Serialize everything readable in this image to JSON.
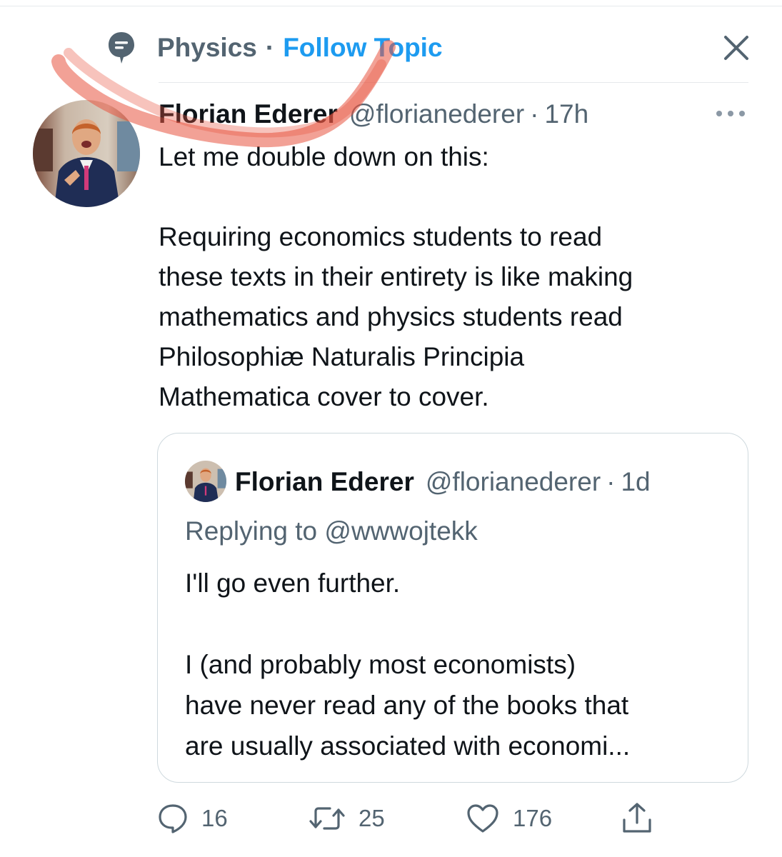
{
  "topic": {
    "name": "Physics",
    "separator": "·",
    "follow_label": "Follow Topic"
  },
  "tweet": {
    "author_name": "Florian Ederer",
    "author_handle": "@florianederer",
    "separator": "·",
    "time": "17h",
    "body_lines": [
      "Let me double down on this:",
      "",
      "Requiring economics students to read",
      "these texts in their entirety is like making",
      "mathematics and physics students read",
      "Philosophiæ Naturalis Principia",
      "Mathematica cover to cover."
    ]
  },
  "quote": {
    "author_name": "Florian Ederer",
    "author_handle": "@florianederer",
    "separator": "·",
    "time": "1d",
    "replying_prefix": "Replying to",
    "replying_handle": "@wwwojtekk",
    "body_lines": [
      "I'll go even further.",
      "",
      "I (and probably most economists)",
      "have never read any of the books that",
      "are usually associated with economi..."
    ]
  },
  "actions": {
    "reply_count": "16",
    "retweet_count": "25",
    "like_count": "176"
  },
  "icons": {
    "topic": "topic-icon",
    "close": "close-icon",
    "more": "more-icon",
    "reply": "reply-icon",
    "retweet": "retweet-icon",
    "like": "heart-icon",
    "share": "share-icon"
  },
  "colors": {
    "link_blue": "#1d9bf0",
    "secondary_text": "#536471",
    "annotation_red": "#e8543f"
  }
}
